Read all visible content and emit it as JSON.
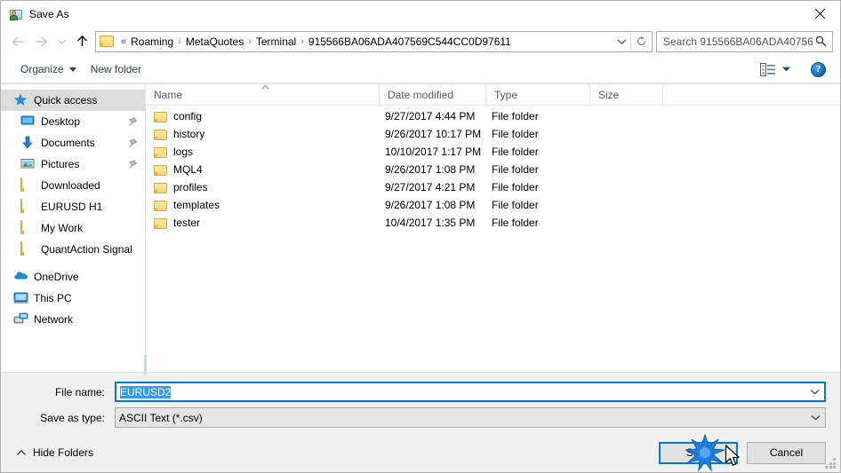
{
  "window": {
    "title": "Save As",
    "title_icon": "save-as-icon",
    "close_icon": "close-icon"
  },
  "navbar": {
    "back_icon": "back-arrow-icon",
    "forward_icon": "forward-arrow-icon",
    "recent_icon": "chevron-down-icon",
    "up_icon": "up-arrow-icon",
    "address_folder_icon": "folder-icon",
    "breadcrumb_overflow": "«",
    "breadcrumbs": [
      "Roaming",
      "MetaQuotes",
      "Terminal",
      "915566BA06ADA407569C544CC0D97611"
    ],
    "breadcrumb_separator": "›",
    "address_dropdown_icon": "chevron-down-icon",
    "refresh_icon": "refresh-icon",
    "search": {
      "placeholder": "Search 915566BA06ADA40756...",
      "icon": "search-icon"
    }
  },
  "toolbar": {
    "organize_label": "Organize",
    "new_folder_label": "New folder",
    "view_icon": "view-layout-icon",
    "view_dropdown_icon": "chevron-down-icon",
    "help_label": "?",
    "help_icon": "help-icon"
  },
  "sidebar": {
    "items": [
      {
        "label": "Quick access",
        "icon": "star-icon",
        "selected": true,
        "group": true,
        "pinned": false
      },
      {
        "label": "Desktop",
        "icon": "desktop-icon",
        "selected": false,
        "group": false,
        "pinned": true
      },
      {
        "label": "Documents",
        "icon": "documents-icon",
        "selected": false,
        "group": false,
        "pinned": true
      },
      {
        "label": "Pictures",
        "icon": "pictures-icon",
        "selected": false,
        "group": false,
        "pinned": true
      },
      {
        "label": "Downloaded",
        "icon": "folder-icon",
        "selected": false,
        "group": false,
        "pinned": false
      },
      {
        "label": "EURUSD H1",
        "icon": "folder-icon",
        "selected": false,
        "group": false,
        "pinned": false
      },
      {
        "label": "My Work",
        "icon": "folder-icon",
        "selected": false,
        "group": false,
        "pinned": false
      },
      {
        "label": "QuantAction Signal",
        "icon": "folder-icon",
        "selected": false,
        "group": false,
        "pinned": false
      },
      {
        "label": "OneDrive",
        "icon": "onedrive-icon",
        "selected": false,
        "group": true,
        "pinned": false
      },
      {
        "label": "This PC",
        "icon": "this-pc-icon",
        "selected": false,
        "group": true,
        "pinned": false
      },
      {
        "label": "Network",
        "icon": "network-icon",
        "selected": false,
        "group": true,
        "pinned": false
      }
    ]
  },
  "filelist": {
    "columns": [
      "Name",
      "Date modified",
      "Type",
      "Size"
    ],
    "sort_column": "Name",
    "sort_direction": "ascending",
    "rows": [
      {
        "name": "config",
        "date": "9/27/2017 4:44 PM",
        "type": "File folder",
        "size": ""
      },
      {
        "name": "history",
        "date": "9/26/2017 10:17 PM",
        "type": "File folder",
        "size": ""
      },
      {
        "name": "logs",
        "date": "10/10/2017 1:17 PM",
        "type": "File folder",
        "size": ""
      },
      {
        "name": "MQL4",
        "date": "9/26/2017 1:08 PM",
        "type": "File folder",
        "size": ""
      },
      {
        "name": "profiles",
        "date": "9/27/2017 4:21 PM",
        "type": "File folder",
        "size": ""
      },
      {
        "name": "templates",
        "date": "9/26/2017 1:08 PM",
        "type": "File folder",
        "size": ""
      },
      {
        "name": "tester",
        "date": "10/4/2017 1:35 PM",
        "type": "File folder",
        "size": ""
      }
    ]
  },
  "form": {
    "file_name_label": "File name:",
    "file_name_value": "EURUSD2",
    "file_name_selected": true,
    "save_as_type_label": "Save as type:",
    "save_as_type_value": "ASCII Text (*.csv)",
    "dropdown_icon": "chevron-down-icon"
  },
  "footer": {
    "hide_folders_label": "Hide Folders",
    "hide_folders_icon": "chevron-up-icon",
    "save_label": "Save",
    "cancel_label": "Cancel",
    "resize_grip_icon": "resize-grip-icon",
    "cursor_icon": "mouse-pointer-icon",
    "click_effect": "click-burst"
  },
  "colors": {
    "accent": "#0078d7",
    "selection": "#3399ff",
    "folder": "#fbd472",
    "header_text": "#44618a",
    "toolbar_text": "#26415e"
  }
}
